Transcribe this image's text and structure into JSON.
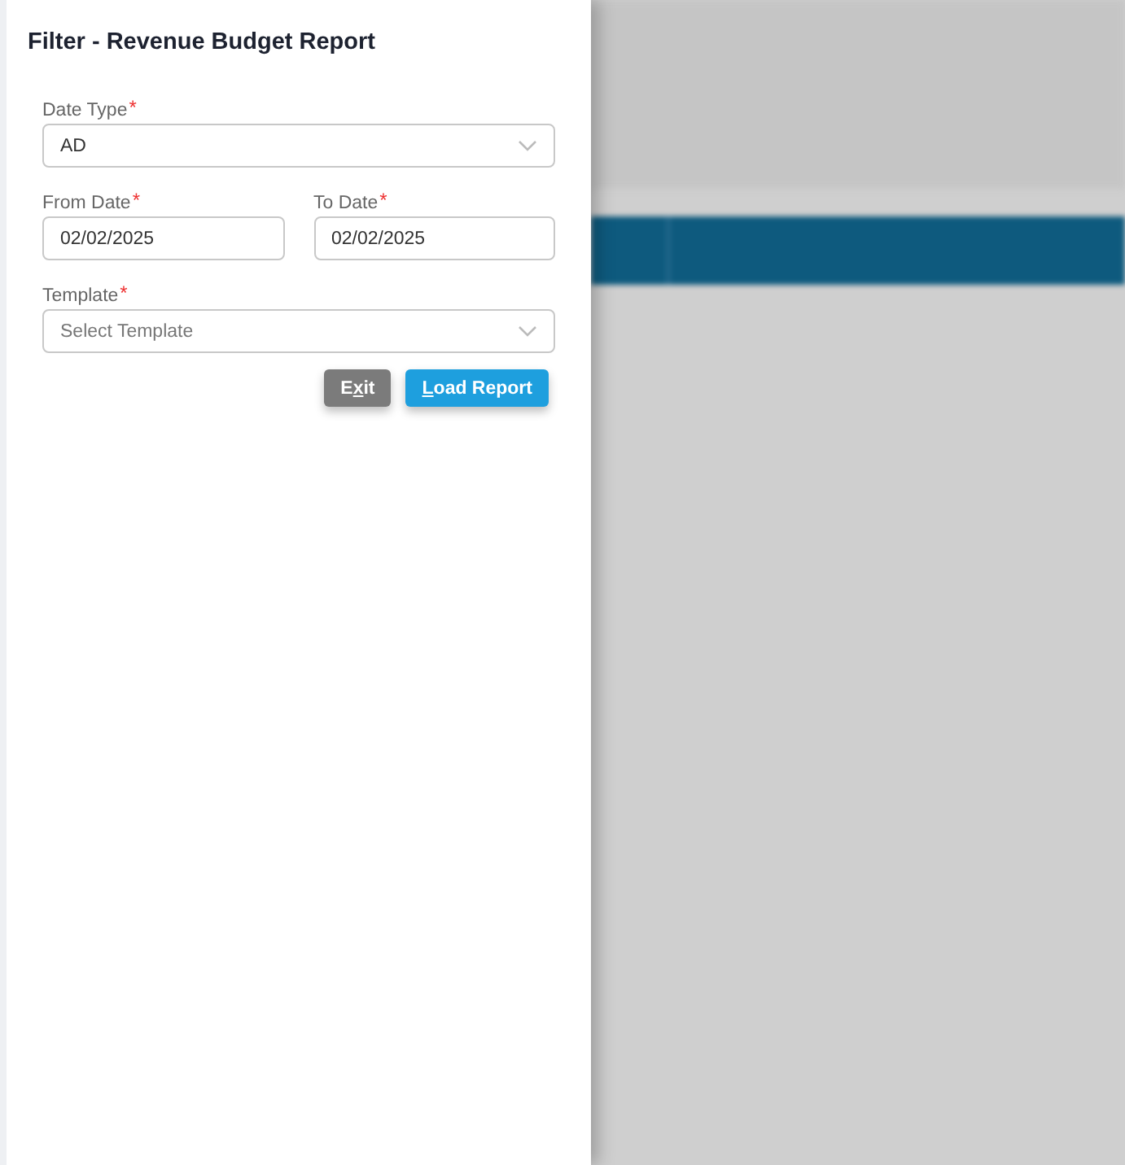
{
  "panel": {
    "title": "Filter - Revenue Budget Report"
  },
  "fields": [
    {
      "kind": "select",
      "label": "Date Type",
      "required_mark": "*",
      "value": "AD"
    },
    {
      "kind": "date",
      "label": "From Date",
      "required_mark": "*",
      "value": "02/02/2025"
    },
    {
      "kind": "date",
      "label": "To Date",
      "required_mark": "*",
      "value": "02/02/2025"
    },
    {
      "kind": "select",
      "label": "Template",
      "required_mark": "*",
      "placeholder": "Select Template"
    }
  ],
  "buttons": [
    {
      "kind": "secondary",
      "label": {
        "before": "E",
        "access_key": "x",
        "after": "it"
      }
    },
    {
      "kind": "primary",
      "label": {
        "access_key": "L",
        "after": "oad Report"
      }
    }
  ]
}
